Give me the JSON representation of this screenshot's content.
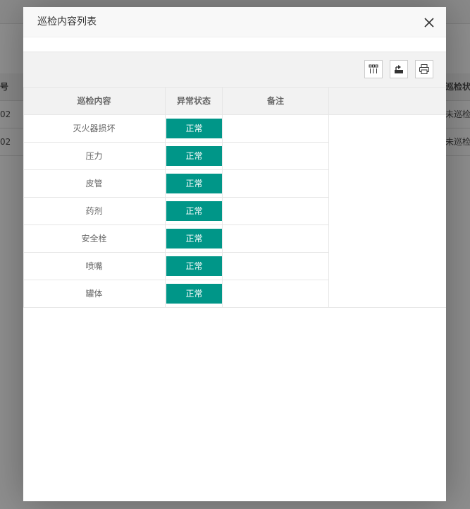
{
  "background": {
    "header_fragment": "巡检状态",
    "row_fragments": [
      {
        "left": "02",
        "right": "未巡检"
      },
      {
        "left": "02",
        "right": "未巡检"
      }
    ],
    "left_header_fragment": "号"
  },
  "modal": {
    "title": "巡检内容列表",
    "close_icon": "close-icon"
  },
  "toolbar": {
    "buttons": [
      {
        "icon": "columns-icon"
      },
      {
        "icon": "export-icon"
      },
      {
        "icon": "print-icon"
      }
    ]
  },
  "table": {
    "columns": [
      "巡检内容",
      "异常状态",
      "备注"
    ],
    "rows": [
      {
        "content": "灭火器损坏",
        "status": "正常",
        "note": ""
      },
      {
        "content": "压力",
        "status": "正常",
        "note": ""
      },
      {
        "content": "皮管",
        "status": "正常",
        "note": ""
      },
      {
        "content": "药剂",
        "status": "正常",
        "note": ""
      },
      {
        "content": "安全栓",
        "status": "正常",
        "note": ""
      },
      {
        "content": "喷嘴",
        "status": "正常",
        "note": ""
      },
      {
        "content": "罐体",
        "status": "正常",
        "note": ""
      }
    ]
  },
  "colors": {
    "status_normal": "#009688",
    "overlay": "#8e8e8e"
  }
}
